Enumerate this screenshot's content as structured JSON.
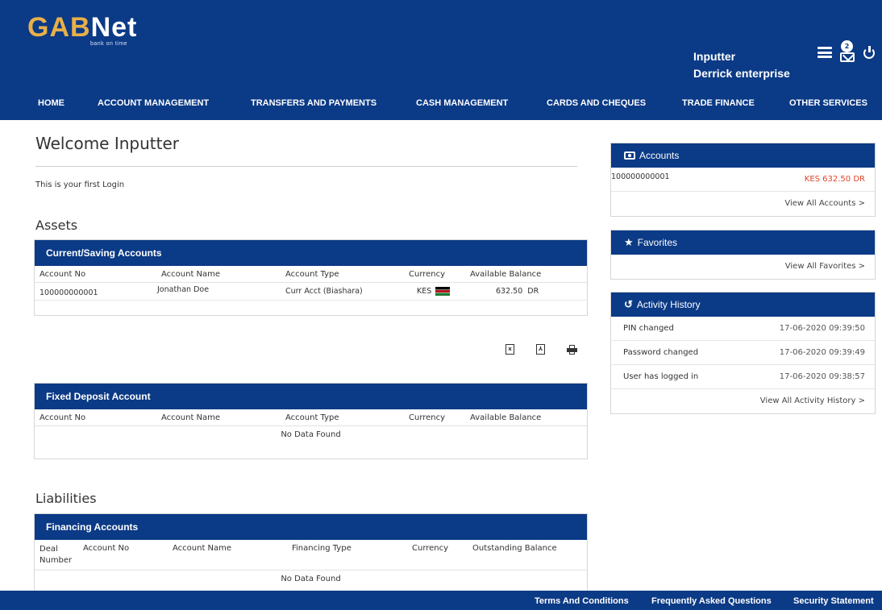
{
  "header": {
    "logo_gab": "GAB",
    "logo_net": "Net",
    "tagline": "bank on time",
    "user_name": "Inputter",
    "company": "Derrick enterprise",
    "mail_badge": "2",
    "icons": [
      "menu-icon",
      "mail-icon",
      "power-icon"
    ]
  },
  "nav": {
    "items": [
      "HOME",
      "ACCOUNT MANAGEMENT",
      "TRANSFERS AND PAYMENTS",
      "CASH MANAGEMENT",
      "CARDS AND CHEQUES",
      "TRADE FINANCE",
      "OTHER SERVICES"
    ]
  },
  "main": {
    "title": "Welcome Inputter",
    "first_login": "This is your first Login",
    "assets_title": "Assets",
    "liabilities_title": "Liabilities",
    "current": {
      "heading": "Current/Saving Accounts",
      "columns": [
        "Account No",
        "Account Name",
        "Account Type",
        "Currency",
        "Available Balance"
      ],
      "rows": [
        {
          "account_no": "100000000001",
          "account_name": "Jonathan Doe",
          "account_type": "Curr Acct (Biashara)",
          "currency": "KES",
          "balance": "632.50",
          "dr": "DR"
        }
      ]
    },
    "export_icons": [
      "excel-export-icon",
      "pdf-export-icon",
      "print-icon"
    ],
    "fixed": {
      "heading": "Fixed Deposit Account",
      "columns": [
        "Account No",
        "Account Name",
        "Account Type",
        "Currency",
        "Available Balance"
      ],
      "empty": "No Data Found"
    },
    "financing": {
      "heading": "Financing Accounts",
      "columns": [
        "Deal Number",
        "Account No",
        "Account Name",
        "Financing Type",
        "Currency",
        "Outstanding Balance"
      ],
      "empty": "No Data Found"
    }
  },
  "sidebar": {
    "accounts": {
      "heading": "Accounts",
      "account_no": "100000000001",
      "balance": "KES 632.50 DR",
      "link": "View All Accounts  >"
    },
    "favorites": {
      "heading": "Favorites",
      "link": "View All Favorites  >"
    },
    "activity": {
      "heading": "Activity History",
      "items": [
        {
          "label": "PIN changed",
          "time": "17-06-2020 09:39:50"
        },
        {
          "label": "Password changed",
          "time": "17-06-2020 09:39:49"
        },
        {
          "label": "User has logged in",
          "time": "17-06-2020 09:38:57"
        }
      ],
      "link": "View All Activity History  >"
    }
  },
  "footer": {
    "links": [
      "Terms And Conditions",
      "Frequently Asked Questions",
      "Security Statement"
    ]
  },
  "colors": {
    "brand": "#0b3a86",
    "logo_gold": "#e8b04a",
    "negative": "#e0452a"
  }
}
